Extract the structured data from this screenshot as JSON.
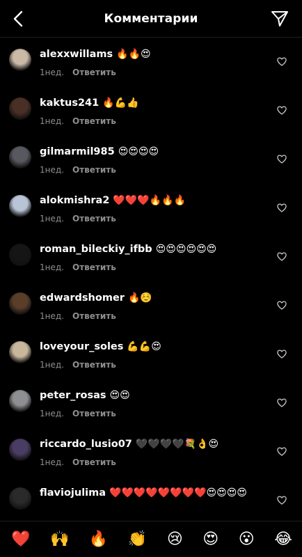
{
  "header": {
    "title": "Комментарии"
  },
  "comments": [
    {
      "user": "alexxwillams",
      "text": "🔥🔥😍",
      "time": "1нед.",
      "reply": "Ответить",
      "avatar_color": "#c9b9a6"
    },
    {
      "user": "kaktus241",
      "text": "🔥💪👍",
      "time": "1нед.",
      "reply": "Ответить",
      "avatar_color": "#4a3024"
    },
    {
      "user": "gilmarmil985",
      "text": "😍😍😍😍",
      "time": "1нед.",
      "reply": "Ответить",
      "avatar_color": "#585860"
    },
    {
      "user": "alokmishra2",
      "text": "❤️❤️❤️🔥🔥🔥",
      "time": "1нед.",
      "reply": "Ответить",
      "avatar_color": "#b9c4d6"
    },
    {
      "user": "roman_bileckiy_ifbb",
      "text": "😍😍😍😍😍😍",
      "time": "1нед.",
      "reply": "Ответить",
      "avatar_color": "#151515"
    },
    {
      "user": "edwardshomer",
      "text": "🔥☺️",
      "time": "1нед.",
      "reply": "Ответить",
      "avatar_color": "#5a3e2a"
    },
    {
      "user": "loveyour_soles",
      "text": "💪💪😍",
      "time": "1нед.",
      "reply": "Ответить",
      "avatar_color": "#c8b79c"
    },
    {
      "user": "peter_rosas",
      "text": "😍😍",
      "time": "1нед.",
      "reply": "Ответить",
      "avatar_color": "#8e8f93"
    },
    {
      "user": "riccardo_lusio07",
      "text": "🖤🖤🖤🖤💐👌😍",
      "time": "1нед.",
      "reply": "Ответить",
      "avatar_color": "#4a3d63"
    },
    {
      "user": "flaviojulima",
      "text": "❤️❤️❤️❤️❤️❤️❤️❤️😍😍😍😍",
      "time": "",
      "reply": "",
      "avatar_color": "#2a2a2a"
    }
  ],
  "emoji_bar": [
    "❤️",
    "🙌",
    "🔥",
    "👏",
    "😢",
    "😍",
    "😮",
    "😂"
  ],
  "colors": {
    "background": "#000000",
    "secondary_text": "#8e8e8e",
    "divider": "#1f1f1f"
  }
}
